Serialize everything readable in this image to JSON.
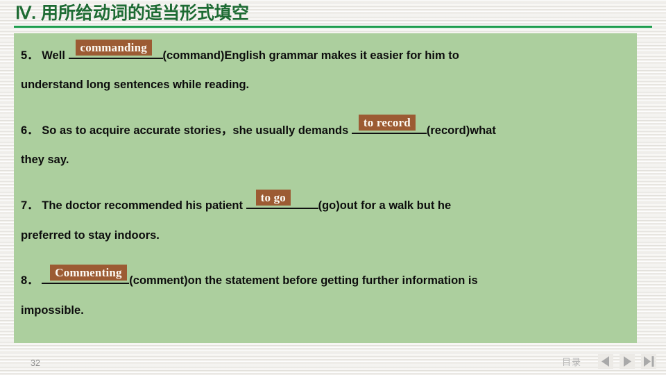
{
  "slide": {
    "title": "Ⅳ. 用所给动词的适当形式填空",
    "accent_green": "#1f9d4e",
    "title_color": "#1d6b33",
    "panel_color": "#accf9e",
    "answer_chip_color": "#9c5b33",
    "answer_text_color": "#fdfaf4"
  },
  "questions": [
    {
      "number": "5．",
      "before": "Well",
      "answer": "commanding",
      "after": "(command)English grammar makes it easier for him to",
      "continuation": "understand long sentences while reading."
    },
    {
      "number": "6．",
      "before": "So as to acquire accurate stories，she usually demands",
      "answer": "to record",
      "after": "(record)what",
      "continuation": "they say."
    },
    {
      "number": "7．",
      "before": "The doctor recommended his patient",
      "answer": "to go",
      "after": "(go)out for a walk but he",
      "continuation": "preferred to stay indoors."
    },
    {
      "number": "8．",
      "before": "",
      "answer": "Commenting",
      "after": "(comment)on the statement before getting further information is",
      "continuation": "impossible."
    }
  ],
  "footer": {
    "page_number": "32",
    "toc_label": "目录",
    "nav": [
      {
        "name": "previous",
        "icon": "triangle-left-icon"
      },
      {
        "name": "next",
        "icon": "triangle-right-icon"
      },
      {
        "name": "last",
        "icon": "triangle-right-bar-icon"
      }
    ]
  }
}
